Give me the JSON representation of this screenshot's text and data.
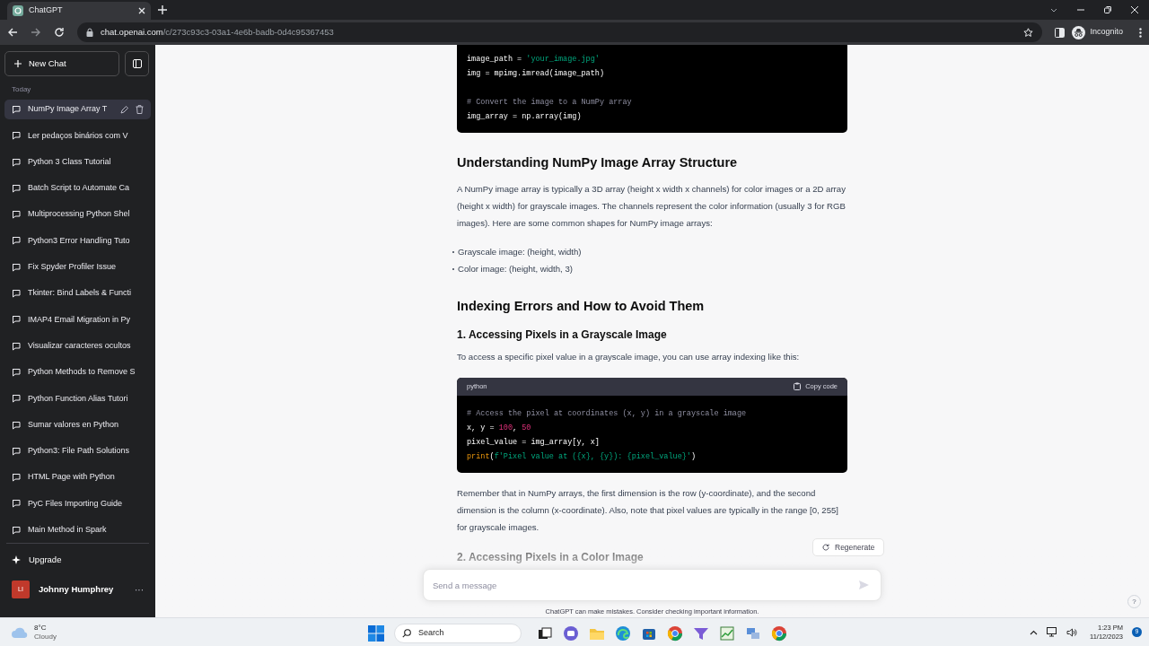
{
  "browser": {
    "tab_title": "ChatGPT",
    "url_host": "chat.openai.com",
    "url_path": "/c/273c93c3-03a1-4e6b-badb-0d4c95367453",
    "profile_label": "Incognito"
  },
  "sidebar": {
    "new_chat_label": "New Chat",
    "section_label": "Today",
    "chats": [
      {
        "title": "NumPy Image Array T",
        "selected": true
      },
      {
        "title": "Ler pedaços binários com V",
        "selected": false
      },
      {
        "title": "Python 3 Class Tutorial",
        "selected": false
      },
      {
        "title": "Batch Script to Automate Ca",
        "selected": false
      },
      {
        "title": "Multiprocessing Python Shel",
        "selected": false
      },
      {
        "title": "Python3 Error Handling Tuto",
        "selected": false
      },
      {
        "title": "Fix Spyder Profiler Issue",
        "selected": false
      },
      {
        "title": "Tkinter: Bind Labels & Functi",
        "selected": false
      },
      {
        "title": "IMAP4 Email Migration in Py",
        "selected": false
      },
      {
        "title": "Visualizar caracteres ocultos",
        "selected": false
      },
      {
        "title": "Python Methods to Remove S",
        "selected": false
      },
      {
        "title": "Python Function Alias Tutori",
        "selected": false
      },
      {
        "title": "Sumar valores en Python",
        "selected": false
      },
      {
        "title": "Python3: File Path Solutions",
        "selected": false
      },
      {
        "title": "HTML Page with Python",
        "selected": false
      },
      {
        "title": "PyC Files Importing Guide",
        "selected": false
      },
      {
        "title": "Main Method in Spark",
        "selected": false
      }
    ],
    "upgrade_label": "Upgrade",
    "user": {
      "initials": "LI",
      "name": "Johnny Humphrey",
      "menu": "···"
    }
  },
  "content": [
    {
      "kind": "code",
      "lines": [
        {
          "kind": "code",
          "tokens": [
            {
              "kind": "plain",
              "text": "image_path = "
            },
            {
              "kind": "string",
              "text": "'your_image.jpg'"
            }
          ]
        },
        {
          "kind": "code",
          "tokens": [
            {
              "kind": "plain",
              "text": "img = mpimg.imread(image_path)"
            }
          ]
        },
        {
          "kind": "blank"
        },
        {
          "kind": "code",
          "tokens": [
            {
              "kind": "comment",
              "text": "# Convert the image to a NumPy array"
            }
          ]
        },
        {
          "kind": "code",
          "tokens": [
            {
              "kind": "plain",
              "text": "img_array = np.array(img)"
            }
          ]
        }
      ]
    },
    {
      "kind": "h2",
      "text": "Understanding NumPy Image Array Structure"
    },
    {
      "kind": "p",
      "text": "A NumPy image array is typically a 3D array (height x width x channels) for color images or a 2D array (height x width) for grayscale images. The channels represent the color information (usually 3 for RGB images). Here are some common shapes for NumPy image arrays:"
    },
    {
      "kind": "list",
      "items": [
        "Grayscale image: (height, width)",
        "Color image: (height, width, 3)"
      ]
    },
    {
      "kind": "h2",
      "text": "Indexing Errors and How to Avoid Them"
    },
    {
      "kind": "h3",
      "text": "1. Accessing Pixels in a Grayscale Image"
    },
    {
      "kind": "p",
      "text": "To access a specific pixel value in a grayscale image, you can use array indexing like this:"
    },
    {
      "kind": "code",
      "language": "python",
      "copy_label": "Copy code",
      "lines": [
        {
          "kind": "code",
          "tokens": [
            {
              "kind": "comment",
              "text": "# Access the pixel at coordinates (x, y) in a grayscale image"
            }
          ]
        },
        {
          "kind": "code",
          "tokens": [
            {
              "kind": "plain",
              "text": "x, y = "
            },
            {
              "kind": "number",
              "text": "100"
            },
            {
              "kind": "plain",
              "text": ", "
            },
            {
              "kind": "number",
              "text": "50"
            }
          ]
        },
        {
          "kind": "code",
          "tokens": [
            {
              "kind": "plain",
              "text": "pixel_value = img_array[y, x]"
            }
          ]
        },
        {
          "kind": "code",
          "tokens": [
            {
              "kind": "builtin",
              "text": "print"
            },
            {
              "kind": "plain",
              "text": "("
            },
            {
              "kind": "string",
              "text": "f'Pixel value at ({x}, {y}): {pixel_value}'"
            },
            {
              "kind": "plain",
              "text": ")"
            }
          ]
        }
      ]
    },
    {
      "kind": "p",
      "text": "Remember that in NumPy arrays, the first dimension is the row (y-coordinate), and the second dimension is the column (x-coordinate). Also, note that pixel values are typically in the range [0, 255] for grayscale images."
    },
    {
      "kind": "h3",
      "text": "2. Accessing Pixels in a Color Image"
    }
  ],
  "regenerate_label": "Regenerate",
  "composer": {
    "placeholder": "Send a message",
    "disclaimer": "ChatGPT can make mistakes. Consider checking important information.",
    "help": "?"
  },
  "taskbar": {
    "weather_temp": "8°C",
    "weather_text": "Cloudy",
    "search_label": "Search",
    "time": "1:23 PM",
    "date": "11/12/2023",
    "notification_count": "9"
  }
}
